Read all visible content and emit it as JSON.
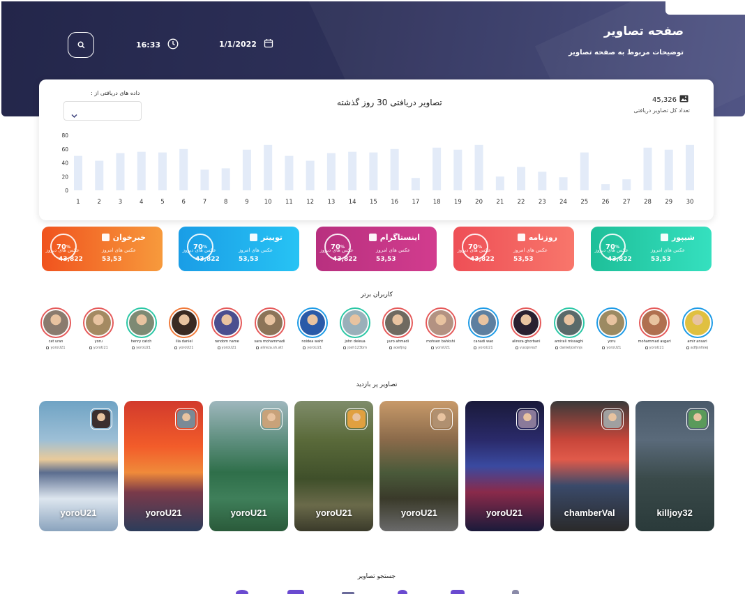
{
  "header": {
    "title": "صفحه تصاویر",
    "subtitle": "توضیحات مربوط به صفحه تصاویر",
    "date": "1/1/2022",
    "time": "16:33"
  },
  "chart_card": {
    "range_label": "داده های دریافتی از :",
    "total_value": "45,326",
    "total_label": "تعداد کل تصاویر دریافتی"
  },
  "chart_data": {
    "type": "bar",
    "title": "تصاویر دریافتی 30 روز گذشته",
    "categories": [
      "1",
      "2",
      "3",
      "4",
      "5",
      "6",
      "7",
      "8",
      "9",
      "10",
      "11",
      "12",
      "13",
      "14",
      "15",
      "16",
      "17",
      "18",
      "19",
      "20",
      "21",
      "22",
      "23",
      "24",
      "25",
      "26",
      "27",
      "28",
      "29",
      "30"
    ],
    "values": [
      50,
      43,
      54,
      56,
      55,
      60,
      30,
      32,
      59,
      66,
      50,
      43,
      54,
      56,
      55,
      60,
      18,
      62,
      59,
      66,
      20,
      34,
      27,
      19,
      55,
      9,
      16,
      62,
      59,
      66
    ],
    "ylim": [
      0,
      80
    ],
    "yticks": [
      "0",
      "20",
      "40",
      "60",
      "80"
    ],
    "grid": false,
    "bar_color": "#e3ebf8"
  },
  "stats": [
    {
      "name": "خبرخوان",
      "percent": "70",
      "today_label": "عکس های امروز",
      "yesterday_label": "عکس های دیروز",
      "today": "53,53",
      "yesterday": "43,822",
      "color_start": "#f0531e",
      "color_end": "#f79a3c"
    },
    {
      "name": "توییتر",
      "percent": "70",
      "today_label": "عکس های امروز",
      "yesterday_label": "عکس های دیروز",
      "today": "53,53",
      "yesterday": "43,822",
      "color_start": "#1a9de6",
      "color_end": "#27c3f4"
    },
    {
      "name": "اینستاگرام",
      "percent": "70",
      "today_label": "عکس های امروز",
      "yesterday_label": "عکس های دیروز",
      "today": "53,53",
      "yesterday": "43,822",
      "color_start": "#b8307f",
      "color_end": "#d23c8e"
    },
    {
      "name": "روزنامه",
      "percent": "70",
      "today_label": "عکس های امروز",
      "yesterday_label": "عکس های دیروز",
      "today": "53,53",
      "yesterday": "43,822",
      "color_start": "#ee4f56",
      "color_end": "#f8766b"
    },
    {
      "name": "شیپور",
      "percent": "70",
      "today_label": "عکس های امروز",
      "yesterday_label": "عکس های دیروز",
      "today": "53,53",
      "yesterday": "43,822",
      "color_start": "#1ebf99",
      "color_end": "#35e0bf"
    }
  ],
  "top_users": {
    "title": "کاربران برتر",
    "users": [
      {
        "name": "cat uran",
        "handle": "yoroU21",
        "ring": "#e55a5a",
        "face": "#8a7b6e"
      },
      {
        "name": "yoru",
        "handle": "yoroU21",
        "ring": "#e55a5a",
        "face": "#a48a62"
      },
      {
        "name": "henry catch",
        "handle": "yoroU21",
        "ring": "#2bc7a5",
        "face": "#7e8a74"
      },
      {
        "name": "ilia daniel",
        "handle": "yoroU21",
        "ring": "#f07a3a",
        "face": "#3a2a22"
      },
      {
        "name": "random name",
        "handle": "yoroU21",
        "ring": "#e55a5a",
        "face": "#4b4f8f"
      },
      {
        "name": "sara mohammadi",
        "handle": "alireza.sh.att",
        "ring": "#e55a5a",
        "face": "#8c7458"
      },
      {
        "name": "noidea waht",
        "handle": "yoroU21",
        "ring": "#1e9be6",
        "face": "#2a5aa8"
      },
      {
        "name": "john deleua",
        "handle": "josh123bm",
        "ring": "#2bc7a5",
        "face": "#9ab0ba"
      },
      {
        "name": "yuro ahmadi",
        "handle": "aoefjng",
        "ring": "#e55a5a",
        "face": "#6f6a60"
      },
      {
        "name": "mohsen bahkshi",
        "handle": "yoroU21",
        "ring": "#e55a5a",
        "face": "#b39282"
      },
      {
        "name": "canadi wao",
        "handle": "yoroU21",
        "ring": "#1e9be6",
        "face": "#5d7fa0"
      },
      {
        "name": "alireza ghorbani",
        "handle": "vuxqnrezf",
        "ring": "#e55a5a",
        "face": "#2a2030"
      },
      {
        "name": "amirali missaghi",
        "handle": "danieljoshnjs",
        "ring": "#2bc7a5",
        "face": "#5a6a6a"
      },
      {
        "name": "yoru",
        "handle": "yoroU21",
        "ring": "#1e9be6",
        "face": "#9c8a62"
      },
      {
        "name": "mohammad asgari",
        "handle": "yoroU21",
        "ring": "#e55a5a",
        "face": "#b07050"
      },
      {
        "name": "amir ansari",
        "handle": "adfjsnfsiej",
        "ring": "#1e9be6",
        "face": "#e0c040"
      }
    ]
  },
  "popular": {
    "title": "تصاویر پر بازدید",
    "items": [
      {
        "user": "yoroU21",
        "bg": "linear-gradient(180deg,#6fa3c4 0%,#9dbfd6 30%,#e9ca9a 45%,#5b6d8f 55%,#dde6ef 75%,#8aa3bd 100%)",
        "thumb": "#3b2e2e"
      },
      {
        "user": "yoroU21",
        "bg": "linear-gradient(180deg,#d23a2c 0%,#f25c2a 35%,#f08a3a 55%,#7a3a4a 70%,#2c3c5a 100%)",
        "thumb": "#7a8a96"
      },
      {
        "user": "yoroU21",
        "bg": "linear-gradient(180deg,#9fb7bd 0%,#5f8f7f 30%,#2f6f4a 55%,#3f7f5a 75%,#2a5a3a 100%)",
        "thumb": "#c8a27a"
      },
      {
        "user": "yoroU21",
        "bg": "linear-gradient(180deg,#7f8c6a 0%,#5a6a3a 30%,#3f4f2a 60%,#6a6a4a 80%,#3a3a2a 100%)",
        "thumb": "#e0a040"
      },
      {
        "user": "yoroU21",
        "bg": "linear-gradient(180deg,#c89a6a 0%,#8a6a4a 30%,#4a5a3a 55%,#3a3a2a 75%,#6a6a6a 100%)",
        "thumb": "#b09070"
      },
      {
        "user": "yoroU21",
        "bg": "linear-gradient(180deg,#1a1a3a 0%,#2a2a6a 30%,#3a4aa0 50%,#8a2a4a 70%,#1a1a3a 100%)",
        "thumb": "#8a7a9a"
      },
      {
        "user": "chamberVal",
        "bg": "linear-gradient(180deg,#3a3a3a 0%,#c8463a 30%,#e05a4a 45%,#3a4a6a 65%,#2a2a2a 100%)",
        "thumb": "#a0a0a0"
      },
      {
        "user": "killjoy32",
        "bg": "linear-gradient(180deg,#4a5a6a 0%,#5a6a7a 30%,#3a4a4a 60%,#2a3a3a 100%)",
        "thumb": "#5a9a5a"
      }
    ]
  },
  "search_section": {
    "title": "جستجو تصاویر"
  }
}
